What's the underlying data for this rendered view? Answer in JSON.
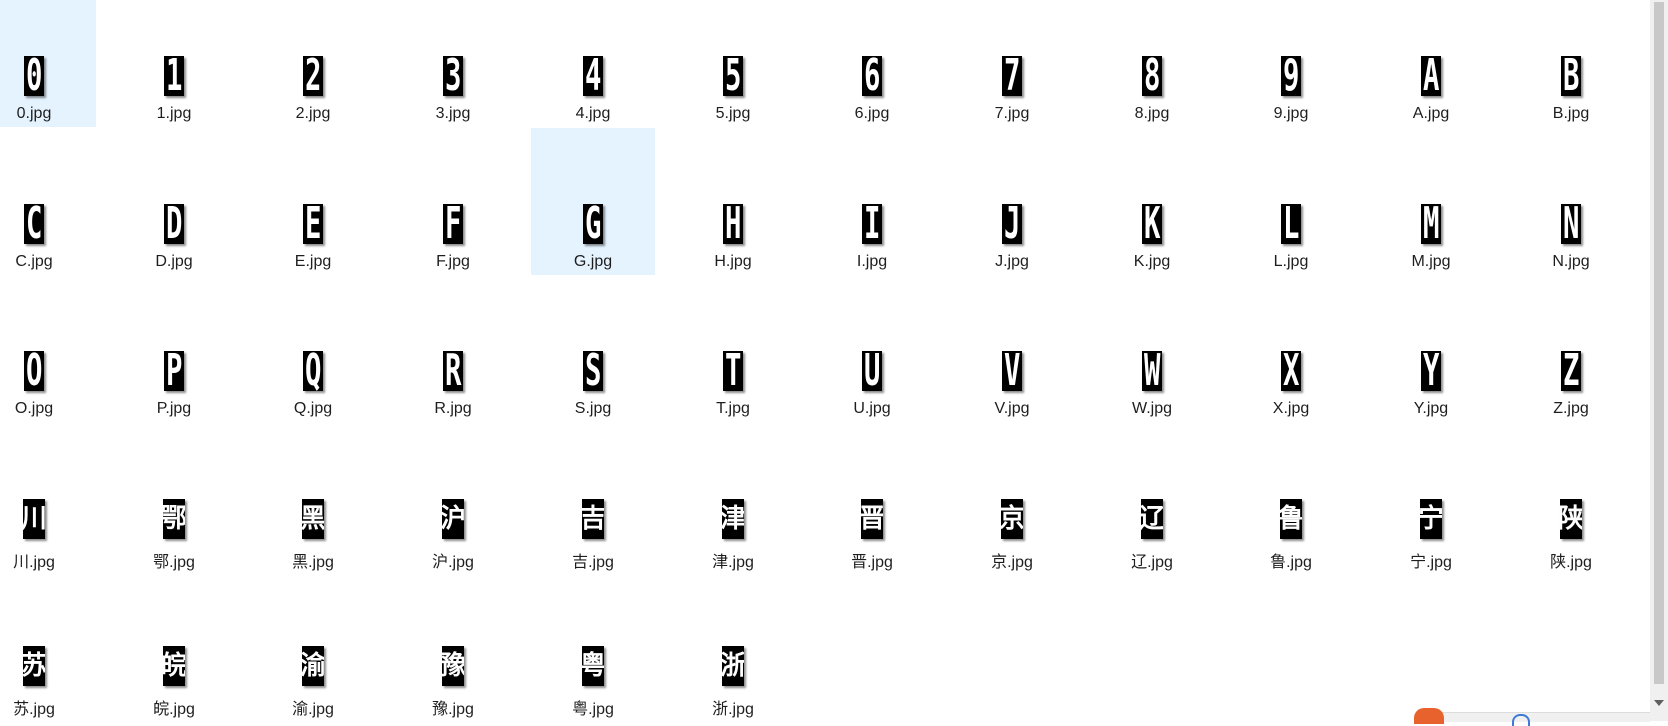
{
  "window": {
    "accent": "#e5f3ff",
    "selected_file": "G.jpg"
  },
  "files": [
    {
      "glyph": "0",
      "name": "0.jpg",
      "kind": "latin"
    },
    {
      "glyph": "1",
      "name": "1.jpg",
      "kind": "latin"
    },
    {
      "glyph": "2",
      "name": "2.jpg",
      "kind": "latin"
    },
    {
      "glyph": "3",
      "name": "3.jpg",
      "kind": "latin"
    },
    {
      "glyph": "4",
      "name": "4.jpg",
      "kind": "latin"
    },
    {
      "glyph": "5",
      "name": "5.jpg",
      "kind": "latin"
    },
    {
      "glyph": "6",
      "name": "6.jpg",
      "kind": "latin"
    },
    {
      "glyph": "7",
      "name": "7.jpg",
      "kind": "latin"
    },
    {
      "glyph": "8",
      "name": "8.jpg",
      "kind": "latin"
    },
    {
      "glyph": "9",
      "name": "9.jpg",
      "kind": "latin"
    },
    {
      "glyph": "A",
      "name": "A.jpg",
      "kind": "latin"
    },
    {
      "glyph": "B",
      "name": "B.jpg",
      "kind": "latin"
    },
    {
      "glyph": "C",
      "name": "C.jpg",
      "kind": "latin"
    },
    {
      "glyph": "D",
      "name": "D.jpg",
      "kind": "latin"
    },
    {
      "glyph": "E",
      "name": "E.jpg",
      "kind": "latin"
    },
    {
      "glyph": "F",
      "name": "F.jpg",
      "kind": "latin"
    },
    {
      "glyph": "G",
      "name": "G.jpg",
      "kind": "latin"
    },
    {
      "glyph": "H",
      "name": "H.jpg",
      "kind": "latin"
    },
    {
      "glyph": "I",
      "name": "I.jpg",
      "kind": "latin"
    },
    {
      "glyph": "J",
      "name": "J.jpg",
      "kind": "latin"
    },
    {
      "glyph": "K",
      "name": "K.jpg",
      "kind": "latin"
    },
    {
      "glyph": "L",
      "name": "L.jpg",
      "kind": "latin"
    },
    {
      "glyph": "M",
      "name": "M.jpg",
      "kind": "latin"
    },
    {
      "glyph": "N",
      "name": "N.jpg",
      "kind": "latin"
    },
    {
      "glyph": "O",
      "name": "O.jpg",
      "kind": "latin"
    },
    {
      "glyph": "P",
      "name": "P.jpg",
      "kind": "latin"
    },
    {
      "glyph": "Q",
      "name": "Q.jpg",
      "kind": "latin"
    },
    {
      "glyph": "R",
      "name": "R.jpg",
      "kind": "latin"
    },
    {
      "glyph": "S",
      "name": "S.jpg",
      "kind": "latin"
    },
    {
      "glyph": "T",
      "name": "T.jpg",
      "kind": "latin"
    },
    {
      "glyph": "U",
      "name": "U.jpg",
      "kind": "latin"
    },
    {
      "glyph": "V",
      "name": "V.jpg",
      "kind": "latin"
    },
    {
      "glyph": "W",
      "name": "W.jpg",
      "kind": "latin"
    },
    {
      "glyph": "X",
      "name": "X.jpg",
      "kind": "latin"
    },
    {
      "glyph": "Y",
      "name": "Y.jpg",
      "kind": "latin"
    },
    {
      "glyph": "Z",
      "name": "Z.jpg",
      "kind": "latin"
    },
    {
      "glyph": "川",
      "name": "川.jpg",
      "kind": "han"
    },
    {
      "glyph": "鄂",
      "name": "鄂.jpg",
      "kind": "han"
    },
    {
      "glyph": "黑",
      "name": "黑.jpg",
      "kind": "han"
    },
    {
      "glyph": "沪",
      "name": "沪.jpg",
      "kind": "han"
    },
    {
      "glyph": "吉",
      "name": "吉.jpg",
      "kind": "han"
    },
    {
      "glyph": "津",
      "name": "津.jpg",
      "kind": "han"
    },
    {
      "glyph": "晋",
      "name": "晋.jpg",
      "kind": "han"
    },
    {
      "glyph": "京",
      "name": "京.jpg",
      "kind": "han"
    },
    {
      "glyph": "辽",
      "name": "辽.jpg",
      "kind": "han"
    },
    {
      "glyph": "鲁",
      "name": "鲁.jpg",
      "kind": "han"
    },
    {
      "glyph": "宁",
      "name": "宁.jpg",
      "kind": "han"
    },
    {
      "glyph": "陕",
      "name": "陕.jpg",
      "kind": "han"
    },
    {
      "glyph": "苏",
      "name": "苏.jpg",
      "kind": "han"
    },
    {
      "glyph": "皖",
      "name": "皖.jpg",
      "kind": "han"
    },
    {
      "glyph": "渝",
      "name": "渝.jpg",
      "kind": "han"
    },
    {
      "glyph": "豫",
      "name": "豫.jpg",
      "kind": "han"
    },
    {
      "glyph": "粤",
      "name": "粤.jpg",
      "kind": "han"
    },
    {
      "glyph": "浙",
      "name": "浙.jpg",
      "kind": "han"
    }
  ]
}
